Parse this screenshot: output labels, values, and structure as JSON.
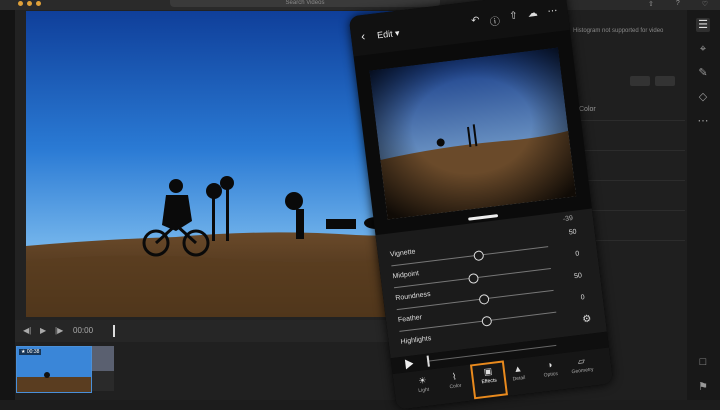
{
  "app": {
    "search_placeholder": "Search Videos"
  },
  "player": {
    "time": "00:00"
  },
  "filmstrip": {
    "badge": "★ 00:38"
  },
  "right_panel": {
    "histogram_message": "Histogram not supported for video",
    "color_label": "Color"
  },
  "phone": {
    "edit_label": "Edit",
    "top_value": "-39",
    "sliders": [
      {
        "label": "Vignette",
        "value": "50",
        "level": 0.55
      },
      {
        "label": "Midpoint",
        "value": "0",
        "level": 0.5
      },
      {
        "label": "Roundness",
        "value": "50",
        "level": 0.55
      },
      {
        "label": "Feather",
        "value": "0",
        "level": 0.55
      }
    ],
    "highlights_label": "Highlights",
    "tabs": [
      {
        "label": "Light",
        "icon": "sun-icon"
      },
      {
        "label": "Color",
        "icon": "thermometer-icon"
      },
      {
        "label": "Effects",
        "icon": "effects-icon",
        "selected": true
      },
      {
        "label": "Detail",
        "icon": "triangle-icon"
      },
      {
        "label": "Optics",
        "icon": "lens-icon"
      },
      {
        "label": "Geometry",
        "icon": "geometry-icon"
      }
    ]
  },
  "colors": {
    "accent_selected": "#e98a1d",
    "filmstrip_selection": "#4a90d9"
  }
}
